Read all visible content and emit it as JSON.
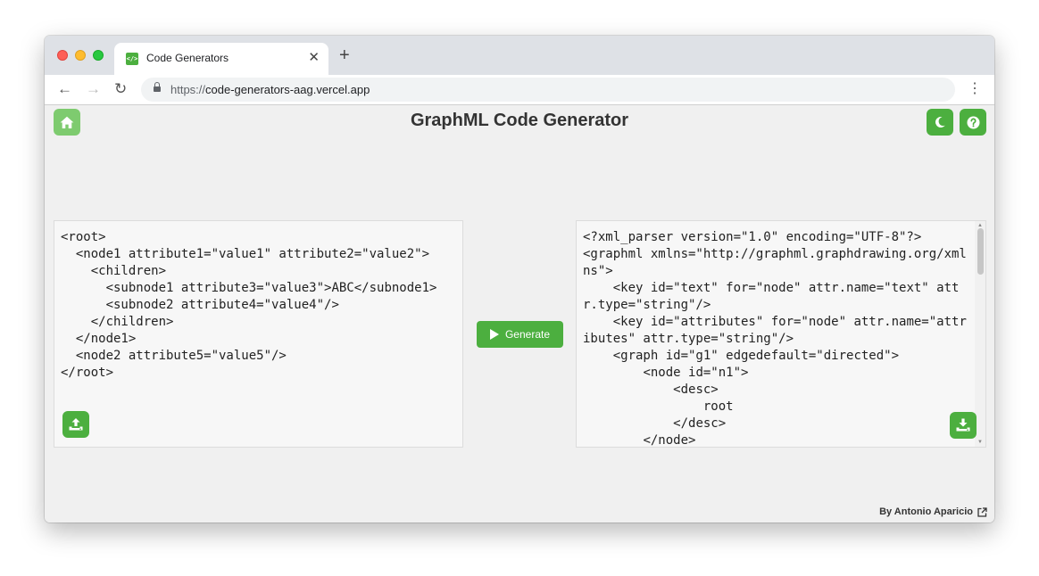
{
  "browser": {
    "tab_title": "Code Generators",
    "tab_favicon": "</>",
    "tab_close": "✕",
    "new_tab": "+",
    "url_scheme": "https://",
    "url_host": "code-generators-aag.vercel.app",
    "nav_back": "←",
    "nav_forward": "→",
    "nav_reload": "↻",
    "menu": "⋮"
  },
  "header": {
    "title": "GraphML Code Generator"
  },
  "editor": {
    "input_code": "<root>\n  <node1 attribute1=\"value1\" attribute2=\"value2\">\n    <children>\n      <subnode1 attribute3=\"value3\">ABC</subnode1>\n      <subnode2 attribute4=\"value4\"/>\n    </children>\n  </node1>\n  <node2 attribute5=\"value5\"/>\n</root>",
    "output_code": "<?xml_parser version=\"1.0\" encoding=\"UTF-8\"?>\n<graphml xmlns=\"http://graphml.graphdrawing.org/xmlns\">\n    <key id=\"text\" for=\"node\" attr.name=\"text\" attr.type=\"string\"/>\n    <key id=\"attributes\" for=\"node\" attr.name=\"attributes\" attr.type=\"string\"/>\n    <graph id=\"g1\" edgedefault=\"directed\">\n        <node id=\"n1\">\n            <desc>\n                root\n            </desc>\n        </node>"
  },
  "actions": {
    "generate_label": "Generate"
  },
  "footer": {
    "credit": "By Antonio Aparicio"
  },
  "icons": {
    "home": "home-icon",
    "theme": "moon-icon",
    "help": "question-icon",
    "upload": "upload-icon",
    "download": "download-icon",
    "play": "play-icon",
    "external": "external-link-icon"
  },
  "colors": {
    "accent": "#4caf3f",
    "home_accent": "#7ecb6f",
    "background": "#f0f0f0"
  }
}
